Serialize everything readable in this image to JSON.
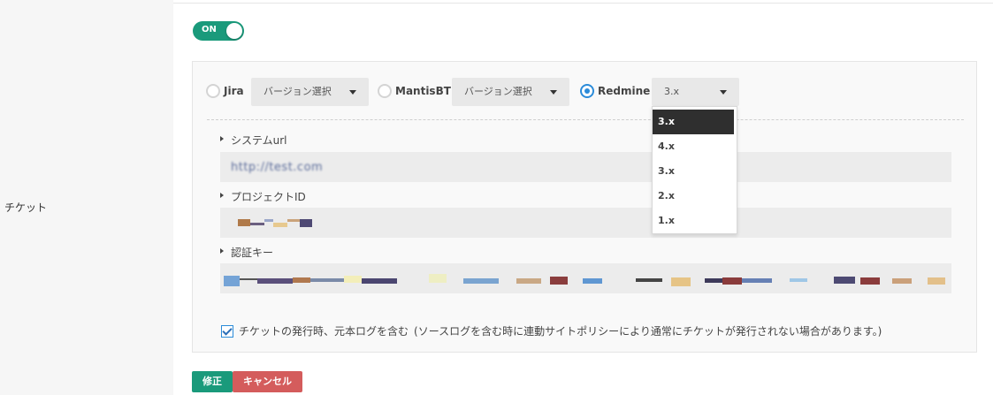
{
  "left": {
    "label": "チケット"
  },
  "toggle": {
    "label": "ON",
    "on": true
  },
  "trackers": {
    "jira": {
      "label": "Jira",
      "checked": false,
      "select": "バージョン選択"
    },
    "mantis": {
      "label": "MantisBT",
      "checked": false,
      "select": "バージョン選択"
    },
    "redmine": {
      "label": "Redmine",
      "checked": true,
      "select": "3.x"
    }
  },
  "dropdown": {
    "options": [
      "3.x",
      "4.x",
      "3.x",
      "2.x",
      "1.x"
    ],
    "highlighted": "3.x"
  },
  "fields": {
    "system_url": {
      "label": "システムurl",
      "value": "http://test.com"
    },
    "project_id": {
      "label": "プロジェクトID"
    },
    "auth_key": {
      "label": "認証キー"
    }
  },
  "include_log": {
    "checked": true,
    "label": "チケットの発行時、元本ログを含む",
    "note": "(ソースログを含む時に連動サイトポリシーにより通常にチケットが発行されない場合があります。)"
  },
  "buttons": {
    "save": "修正",
    "cancel": "キャンセル"
  },
  "colors": {
    "accent": "#1a9a7b",
    "radio": "#2b8bd9",
    "cancel": "#d45c5c"
  }
}
